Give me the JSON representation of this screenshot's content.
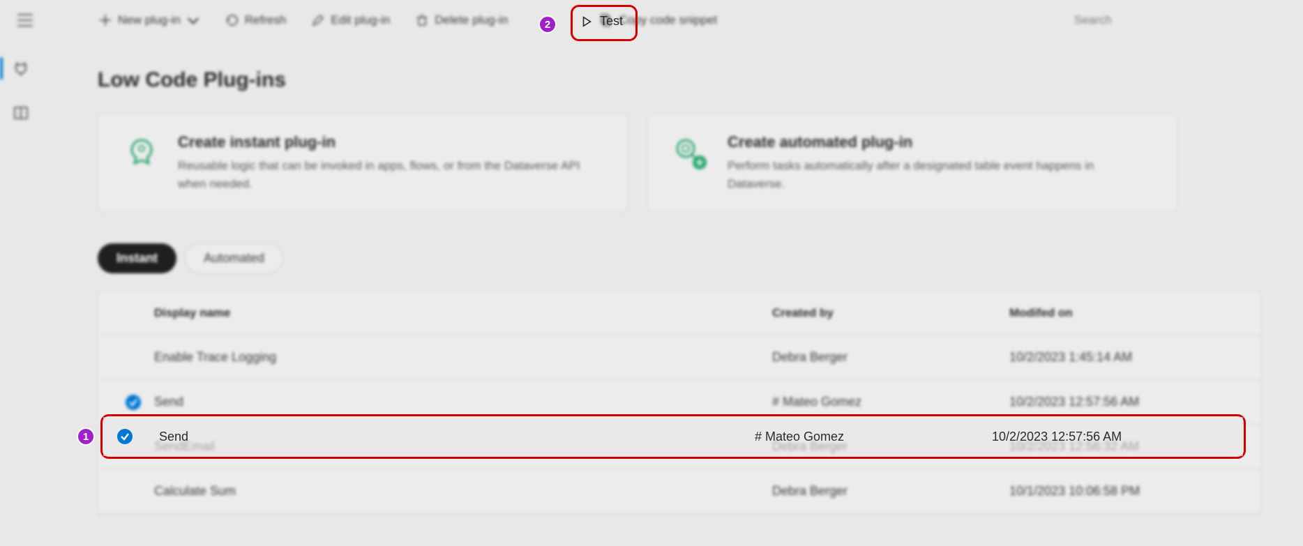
{
  "toolbar": {
    "new_plugin": "New plug-in",
    "refresh": "Refresh",
    "edit": "Edit plug-in",
    "delete": "Delete plug-in",
    "test": "Test",
    "copy": "Copy code snippet"
  },
  "search": {
    "placeholder": "Search"
  },
  "page": {
    "title": "Low Code Plug-ins"
  },
  "cards": {
    "instant": {
      "title": "Create instant plug-in",
      "desc": "Reusable logic that can be invoked in apps, flows, or from the Dataverse API when needed."
    },
    "automated": {
      "title": "Create automated plug-in",
      "desc": "Perform tasks automatically after a designated table event happens in Dataverse."
    }
  },
  "tabs": {
    "instant": "Instant",
    "automated": "Automated"
  },
  "table": {
    "headers": {
      "display_name": "Display name",
      "created_by": "Created by",
      "modified_on": "Modifed on"
    },
    "rows": [
      {
        "selected": false,
        "name": "Enable Trace Logging",
        "created_by": "Debra Berger",
        "modified_on": "10/2/2023 1:45:14 AM"
      },
      {
        "selected": true,
        "name": "Send",
        "created_by": "# Mateo Gomez",
        "modified_on": "10/2/2023 12:57:56 AM"
      },
      {
        "selected": false,
        "name": "SendEmail",
        "created_by": "Debra Berger",
        "modified_on": "10/2/2023 12:56:32 AM"
      },
      {
        "selected": false,
        "name": "Calculate Sum",
        "created_by": "Debra Berger",
        "modified_on": "10/1/2023 10:06:58 PM"
      }
    ]
  },
  "callouts": {
    "badge1": "1",
    "badge2": "2"
  }
}
